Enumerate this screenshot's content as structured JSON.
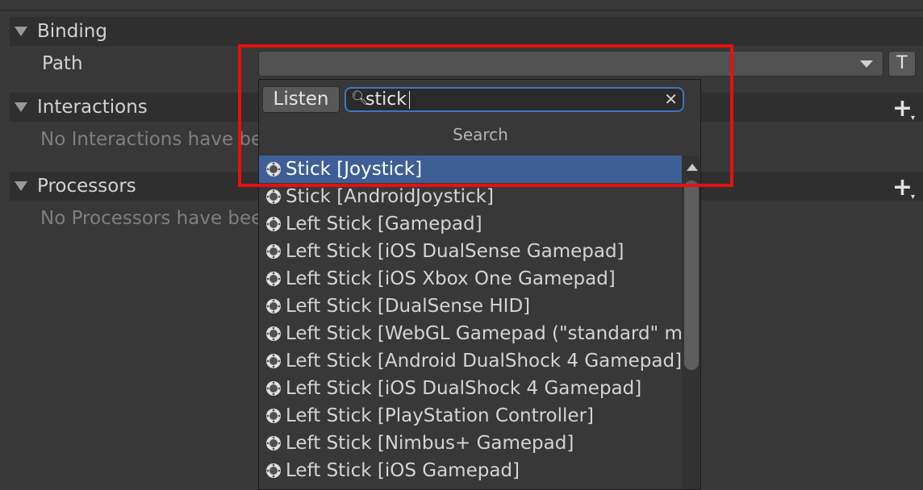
{
  "binding_section": {
    "title": "Binding",
    "path_label": "Path",
    "t_button": "T"
  },
  "interactions_section": {
    "title": "Interactions",
    "empty_text": "No Interactions have bee",
    "add_icon": "plus-icon"
  },
  "processors_section": {
    "title": "Processors",
    "empty_text": "No Processors have bee",
    "add_icon": "plus-icon"
  },
  "picker": {
    "listen_label": "Listen",
    "search_value": "stick",
    "search_title": "Search",
    "items": [
      "Stick [Joystick]",
      "Stick [AndroidJoystick]",
      "Left Stick [Gamepad]",
      "Left Stick [iOS DualSense Gamepad]",
      "Left Stick [iOS Xbox One Gamepad]",
      "Left Stick [DualSense HID]",
      "Left Stick [WebGL Gamepad (\"standard\" ma",
      "Left Stick [Android DualShock 4 Gamepad]",
      "Left Stick [iOS DualShock 4 Gamepad]",
      "Left Stick [PlayStation Controller]",
      "Left Stick [Nimbus+ Gamepad]",
      "Left Stick [iOS Gamepad]"
    ],
    "selected_index": 0
  },
  "colors": {
    "accent": "#3a79bb",
    "selection": "#3e5f96",
    "highlight_box": "#e51010"
  }
}
